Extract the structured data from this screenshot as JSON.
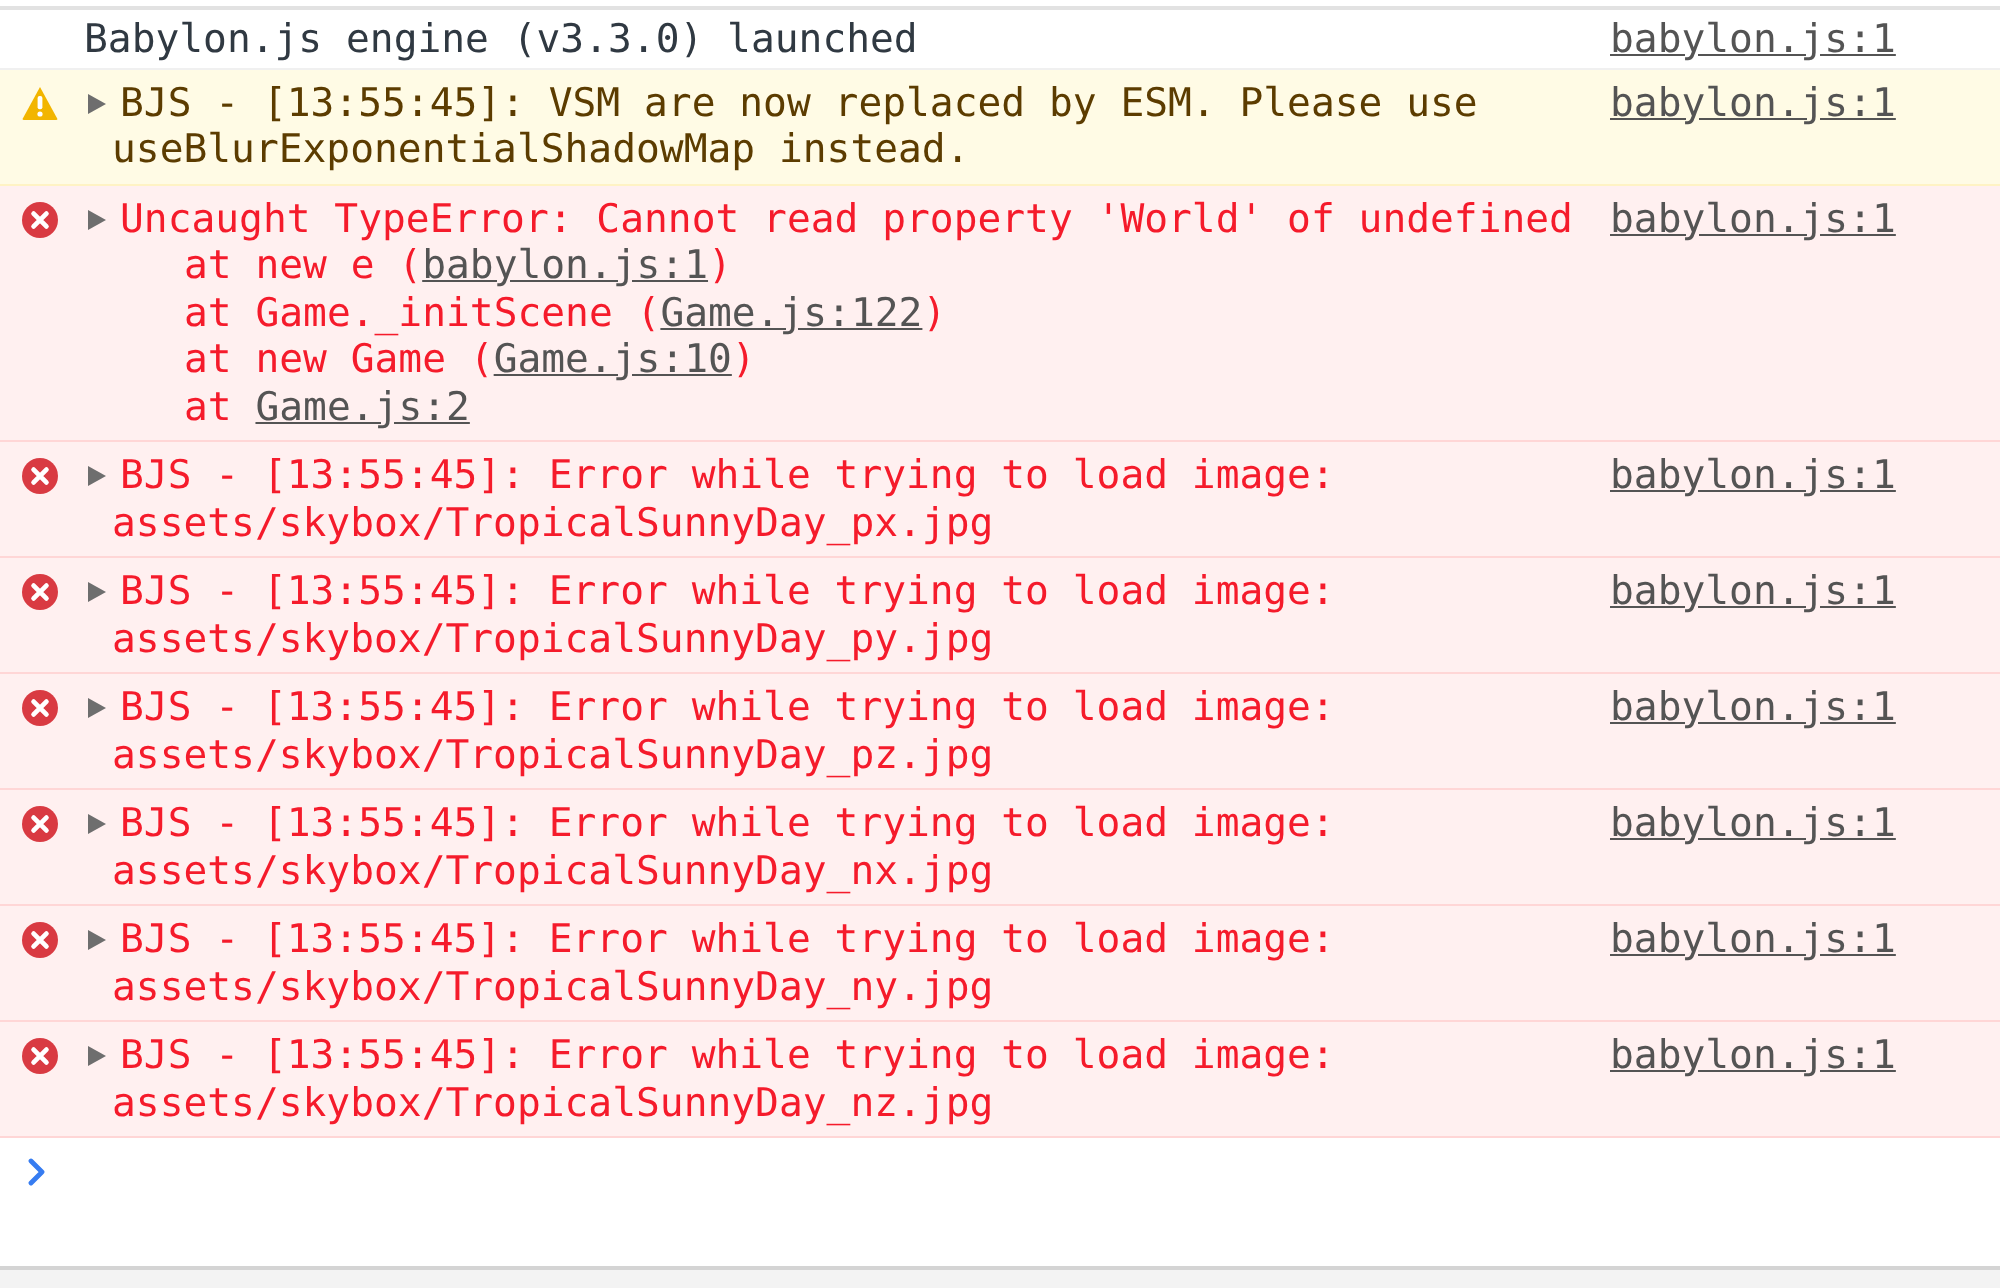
{
  "messages": [
    {
      "kind": "log",
      "text": "Babylon.js engine (v3.3.0) launched",
      "source": "babylon.js:1"
    },
    {
      "kind": "warning",
      "expanded": false,
      "text": "BJS - [13:55:45]: VSM are now replaced by ESM. Please use useBlurExponentialShadowMap instead.",
      "source": "babylon.js:1"
    },
    {
      "kind": "error",
      "expanded": false,
      "text": "Uncaught TypeError: Cannot read property 'World' of undefined",
      "source": "babylon.js:1",
      "stack": [
        {
          "text": "at new e (",
          "link": "babylon.js:1",
          "after": ")"
        },
        {
          "text": "at Game._initScene (",
          "link": "Game.js:122",
          "after": ")"
        },
        {
          "text": "at new Game (",
          "link": "Game.js:10",
          "after": ")"
        },
        {
          "text": "at ",
          "link": "Game.js:2"
        }
      ]
    },
    {
      "kind": "error",
      "expanded": false,
      "text": "BJS - [13:55:45]: Error while trying to load image: assets/skybox/TropicalSunnyDay_px.jpg",
      "source": "babylon.js:1"
    },
    {
      "kind": "error",
      "expanded": false,
      "text": "BJS - [13:55:45]: Error while trying to load image: assets/skybox/TropicalSunnyDay_py.jpg",
      "source": "babylon.js:1"
    },
    {
      "kind": "error",
      "expanded": false,
      "text": "BJS - [13:55:45]: Error while trying to load image: assets/skybox/TropicalSunnyDay_pz.jpg",
      "source": "babylon.js:1"
    },
    {
      "kind": "error",
      "expanded": false,
      "text": "BJS - [13:55:45]: Error while trying to load image: assets/skybox/TropicalSunnyDay_nx.jpg",
      "source": "babylon.js:1"
    },
    {
      "kind": "error",
      "expanded": false,
      "text": "BJS - [13:55:45]: Error while trying to load image: assets/skybox/TropicalSunnyDay_ny.jpg",
      "source": "babylon.js:1"
    },
    {
      "kind": "error",
      "expanded": false,
      "text": "BJS - [13:55:45]: Error while trying to load image: assets/skybox/TropicalSunnyDay_nz.jpg",
      "source": "babylon.js:1"
    }
  ]
}
